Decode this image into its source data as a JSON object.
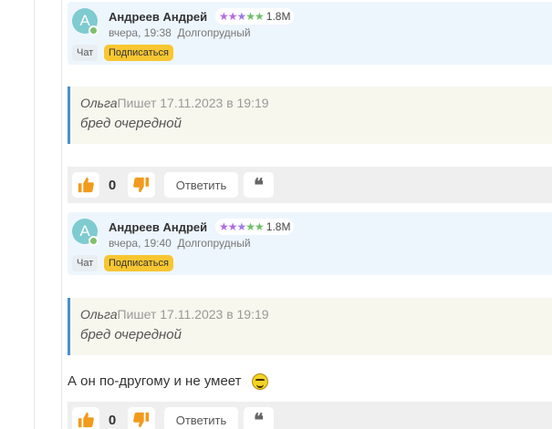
{
  "comments": [
    {
      "author": {
        "avatar_letter": "A",
        "name": "Андреев Андрей",
        "rating_stars": "★★★★★",
        "rating_value": "1.8M",
        "time": "вчера, 19:38",
        "city": "Долгопрудный",
        "chat_label": "Чат",
        "subscribe_label": "Подписаться"
      },
      "quote": {
        "author": "Ольга",
        "header": "Пишет 17.11.2023 в 19:19",
        "text": "бред очередной"
      },
      "body": "",
      "actions": {
        "like_count": "0",
        "reply_label": "Ответить",
        "quote_label": "❝"
      }
    },
    {
      "author": {
        "avatar_letter": "A",
        "name": "Андреев Андрей",
        "rating_stars": "★★★★★",
        "rating_value": "1.8M",
        "time": "вчера, 19:40",
        "city": "Долгопрудный",
        "chat_label": "Чат",
        "subscribe_label": "Подписаться"
      },
      "quote": {
        "author": "Ольга",
        "header": "Пишет 17.11.2023 в 19:19",
        "text": "бред очередной"
      },
      "body": "А он по-другому и не умеет",
      "actions": {
        "like_count": "0",
        "reply_label": "Ответить",
        "quote_label": "❝"
      }
    }
  ],
  "icons": {
    "like": "thumbs-up-icon",
    "dislike": "thumbs-down-icon",
    "emoji": "smiley-icon",
    "quote": "quote-icon"
  },
  "colors": {
    "author_card_bg": "#eef6fd",
    "quote_bg": "#f7f7ee",
    "quote_border": "#4a8fd4",
    "subscribe_bg": "#f7c631",
    "thumb_color": "#f29a1c",
    "action_bar_bg": "#efefef"
  }
}
